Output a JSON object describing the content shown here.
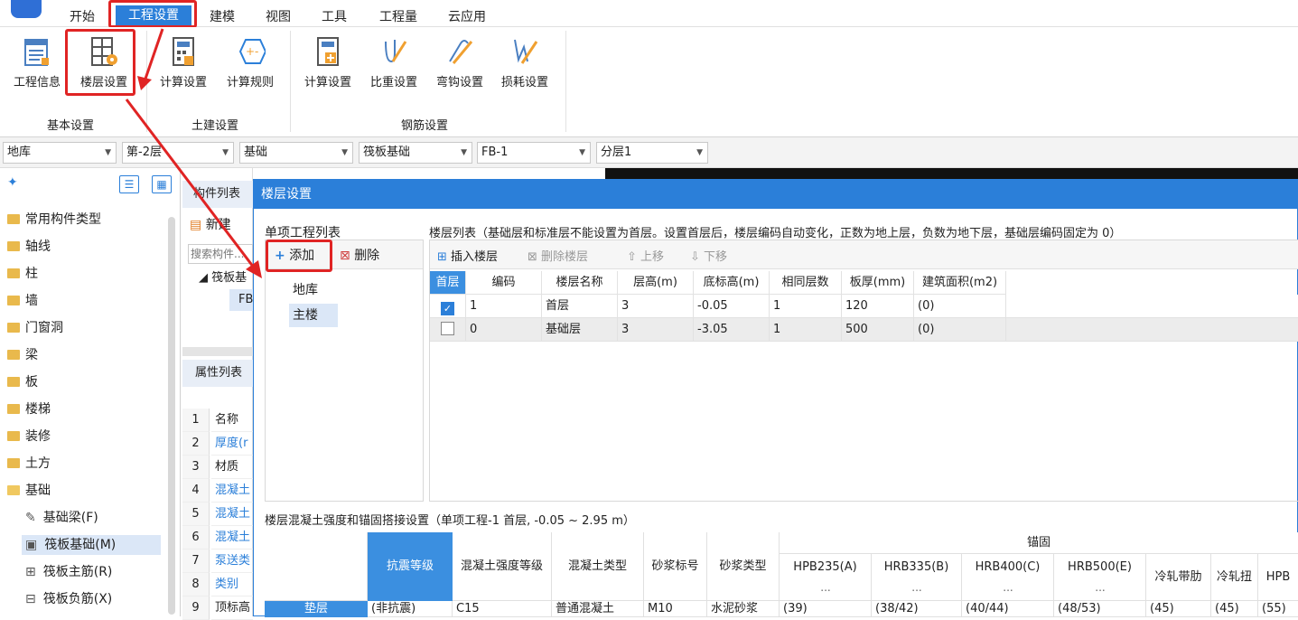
{
  "menu": {
    "items": [
      "开始",
      "工程设置",
      "建模",
      "视图",
      "工具",
      "工程量",
      "云应用"
    ],
    "active": "工程设置"
  },
  "ribbon": {
    "basic": {
      "label": "基本设置",
      "btn1": "工程信息",
      "btn2": "楼层设置"
    },
    "civil": {
      "label": "土建设置",
      "btn1": "计算设置",
      "btn2": "计算规则"
    },
    "rebar": {
      "label": "钢筋设置",
      "btn1": "计算设置",
      "btn2": "比重设置",
      "btn3": "弯钩设置",
      "btn4": "损耗设置"
    }
  },
  "combos": [
    "地库",
    "第-2层",
    "基础",
    "筏板基础",
    "FB-1",
    "分层1"
  ],
  "left_tree": {
    "items": [
      "常用构件类型",
      "轴线",
      "柱",
      "墙",
      "门窗洞",
      "梁",
      "板",
      "楼梯",
      "装修",
      "土方",
      "基础"
    ],
    "sub_items": [
      "基础梁(F)",
      "筏板基础(M)",
      "筏板主筋(R)",
      "筏板负筋(X)"
    ]
  },
  "mid_panel": {
    "title": "构件列表",
    "new_label": "新建",
    "search_placeholder": "搜索构件...",
    "tree_node": "筏板基",
    "tree_child": "FB",
    "props_title": "属性列表",
    "props": [
      {
        "n": "1",
        "name": "名称"
      },
      {
        "n": "2",
        "name": "厚度(r"
      },
      {
        "n": "3",
        "name": "材质"
      },
      {
        "n": "4",
        "name": "混凝土"
      },
      {
        "n": "5",
        "name": "混凝土"
      },
      {
        "n": "6",
        "name": "混凝土"
      },
      {
        "n": "7",
        "name": "泵送类"
      },
      {
        "n": "8",
        "name": "类别"
      },
      {
        "n": "9",
        "name": "顶标高"
      }
    ]
  },
  "dialog": {
    "title": "楼层设置",
    "project_list_label": "单项工程列表",
    "add_label": "添加",
    "delete_label": "删除",
    "projects": [
      "地库",
      "主楼"
    ],
    "floor_list_note": "楼层列表（基础层和标准层不能设置为首层。设置首层后，楼层编码自动变化，正数为地上层，负数为地下层，基础层编码固定为 0）",
    "toolbar": {
      "insert": "插入楼层",
      "remove": "删除楼层",
      "up": "上移",
      "down": "下移"
    },
    "floor_headers": [
      "首层",
      "编码",
      "楼层名称",
      "层高(m)",
      "底标高(m)",
      "相同层数",
      "板厚(mm)",
      "建筑面积(m2)"
    ],
    "floors": [
      {
        "first": true,
        "code": "1",
        "name": "首层",
        "height": "3",
        "bottom": "-0.05",
        "same": "1",
        "slab": "120",
        "area": "(0)"
      },
      {
        "first": false,
        "code": "0",
        "name": "基础层",
        "height": "3",
        "bottom": "-3.05",
        "same": "1",
        "slab": "500",
        "area": "(0)"
      }
    ],
    "concrete_title": "楼层混凝土强度和锚固搭接设置（单项工程-1 首层, -0.05 ~ 2.95 m）",
    "concrete_headers": {
      "seismic": "抗震等级",
      "grade": "混凝土强度等级",
      "type": "混凝土类型",
      "mortar": "砂浆标号",
      "mortar_type": "砂浆类型",
      "anchor": "锚固",
      "hpb235": "HPB235(A)",
      "hrb335": "HRB335(B)",
      "hrb400": "HRB400(C)",
      "hrb500": "HRB500(E)",
      "cold_ribbed": "冷轧带肋",
      "cold_twisted": "冷轧扭",
      "hpb_cut": "HPB",
      "ellipsis": "..."
    },
    "concrete_row": {
      "label": "垫层",
      "seismic": "(非抗震)",
      "grade": "C15",
      "type": "普通混凝土",
      "mortar": "M10",
      "mortar_type": "水泥砂浆",
      "hpb235": "(39)",
      "hrb335": "(38/42)",
      "hrb400": "(40/44)",
      "hrb500": "(48/53)",
      "cold_ribbed": "(45)",
      "cold_twisted": "(45)",
      "hpb_cut": "(55)"
    }
  },
  "colors": {
    "accent": "#2b7fd9",
    "annotation": "#e02424",
    "header_blue": "#3b8fe0"
  }
}
